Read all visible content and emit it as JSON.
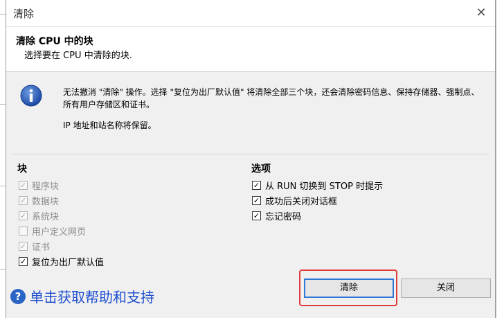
{
  "window": {
    "title": "清除"
  },
  "header": {
    "title": "清除 CPU 中的块",
    "subtitle": "选择要在 CPU 中清除的块."
  },
  "info": {
    "message": "无法撤消 \"清除\" 操作。选择 \"复位为出厂默认值\" 将清除全部三个块，还会清除密码信息、保持存储器、强制点、所有用户存储区和证书。",
    "note": "IP 地址和站名称将保留。"
  },
  "blocks": {
    "title": "块",
    "items": [
      {
        "label": "程序块",
        "checked": true,
        "enabled": false
      },
      {
        "label": "数据块",
        "checked": true,
        "enabled": false
      },
      {
        "label": "系统块",
        "checked": true,
        "enabled": false
      },
      {
        "label": "用户定义网页",
        "checked": false,
        "enabled": false
      },
      {
        "label": "证书",
        "checked": true,
        "enabled": false
      },
      {
        "label": "复位为出厂默认值",
        "checked": true,
        "enabled": true
      }
    ]
  },
  "options": {
    "title": "选项",
    "items": [
      {
        "label": "从 RUN 切换到 STOP 时提示",
        "checked": true
      },
      {
        "label": "成功后关闭对话框",
        "checked": true
      },
      {
        "label": "忘记密码",
        "checked": true
      }
    ]
  },
  "help": {
    "label": "单击获取帮助和支持"
  },
  "buttons": {
    "clear": "清除",
    "close": "关闭"
  },
  "icons": {
    "info": "info-icon",
    "help": "help-icon",
    "close": "close-icon"
  },
  "colors": {
    "accent": "#2f78d6",
    "help_link": "#1f4fd0",
    "annotation": "#e03b3b"
  }
}
